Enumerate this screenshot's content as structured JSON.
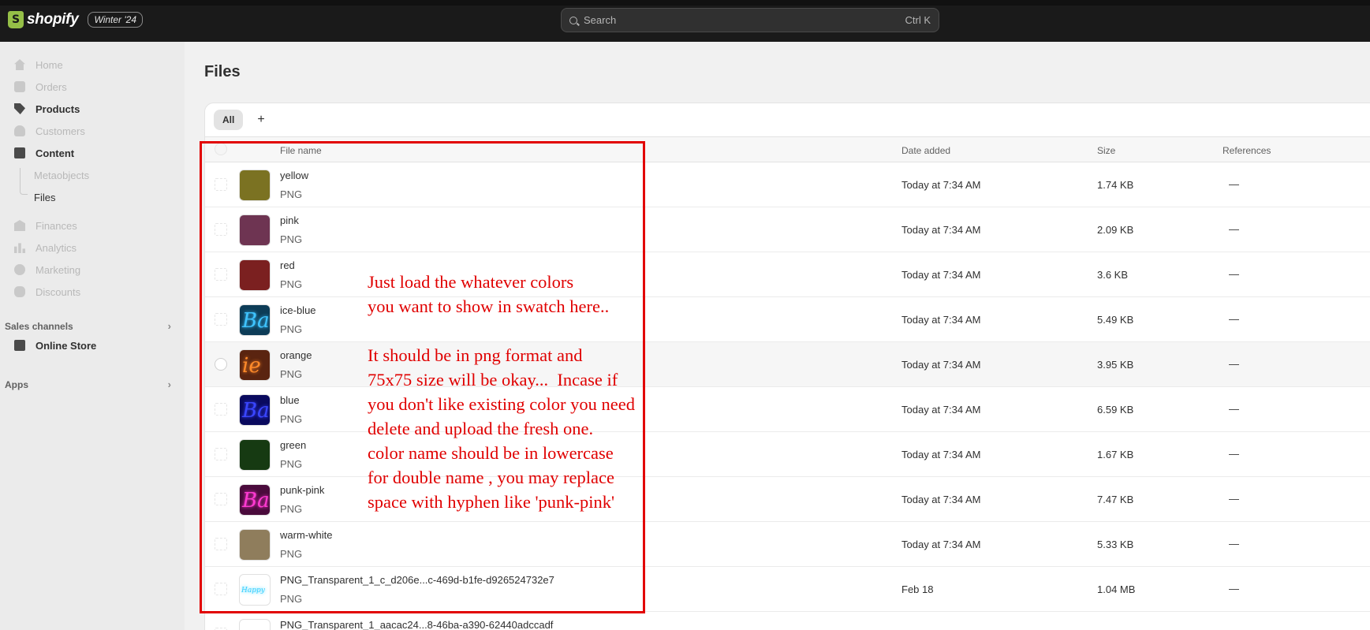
{
  "topbar": {
    "brand": "shopify",
    "version_badge": "Winter '24",
    "search_placeholder": "Search",
    "search_shortcut": "Ctrl K"
  },
  "sidebar": {
    "items": [
      {
        "label": "Home"
      },
      {
        "label": "Orders"
      },
      {
        "label": "Products"
      },
      {
        "label": "Customers"
      },
      {
        "label": "Content"
      },
      {
        "label": "Metaobjects"
      },
      {
        "label": "Files"
      },
      {
        "label": "Finances"
      },
      {
        "label": "Analytics"
      },
      {
        "label": "Marketing"
      },
      {
        "label": "Discounts"
      }
    ],
    "sales_channels": "Sales channels",
    "online_store": "Online Store",
    "apps": "Apps"
  },
  "page": {
    "title": "Files",
    "tab_all": "All",
    "tab_add": "+"
  },
  "table": {
    "headers": {
      "name": "File name",
      "date": "Date added",
      "size": "Size",
      "refs": "References"
    },
    "rows": [
      {
        "name": "yellow",
        "type": "PNG",
        "date": "Today at 7:34 AM",
        "size": "1.74 KB",
        "refs": "—",
        "swatch": "#7b7222"
      },
      {
        "name": "pink",
        "type": "PNG",
        "date": "Today at 7:34 AM",
        "size": "2.09 KB",
        "refs": "—",
        "swatch": "#6e3452"
      },
      {
        "name": "red",
        "type": "PNG",
        "date": "Today at 7:34 AM",
        "size": "3.6 KB",
        "refs": "—",
        "swatch": "#7b2020"
      },
      {
        "name": "ice-blue",
        "type": "PNG",
        "date": "Today at 7:34 AM",
        "size": "5.49 KB",
        "refs": "—",
        "swatch": "#0d3c57",
        "neon": "#3fc4ff",
        "neon_text": "Ba"
      },
      {
        "name": "orange",
        "type": "PNG",
        "date": "Today at 7:34 AM",
        "size": "3.95 KB",
        "refs": "—",
        "swatch": "#5a2410",
        "neon": "#ff8a2a",
        "neon_text": "ie"
      },
      {
        "name": "blue",
        "type": "PNG",
        "date": "Today at 7:34 AM",
        "size": "6.59 KB",
        "refs": "—",
        "swatch": "#0a0a5e",
        "neon": "#3a46ff",
        "neon_text": "Ba"
      },
      {
        "name": "green",
        "type": "PNG",
        "date": "Today at 7:34 AM",
        "size": "1.67 KB",
        "refs": "—",
        "swatch": "#163a12"
      },
      {
        "name": "punk-pink",
        "type": "PNG",
        "date": "Today at 7:34 AM",
        "size": "7.47 KB",
        "refs": "—",
        "swatch": "#4a0b3c",
        "neon": "#ff3ad2",
        "neon_text": "Ba"
      },
      {
        "name": "warm-white",
        "type": "PNG",
        "date": "Today at 7:34 AM",
        "size": "5.33 KB",
        "refs": "—",
        "swatch": "#8f7d5c"
      },
      {
        "name": "PNG_Transparent_1_c_d206e...c-469d-b1fe-d926524732e7",
        "type": "PNG",
        "date": "Feb 18",
        "size": "1.04 MB",
        "refs": "—",
        "swatch": "#ffffff",
        "neon": "#37d0ff",
        "neon_text": "Happy"
      },
      {
        "name": "PNG_Transparent_1_aacac24...8-46ba-a390-62440adccadf",
        "type": "",
        "date": "",
        "size": "",
        "refs": "",
        "swatch": "#ffffff"
      }
    ]
  },
  "annotation": {
    "line1": "Just load the whatever colors",
    "line2": "you want to show in swatch here..",
    "line3": "It should be in png format and",
    "line4": "75x75 size will be okay...  Incase if",
    "line5": "you don't like existing color you need",
    "line6": "delete and upload the fresh one.",
    "line7": "color name should be in lowercase",
    "line8": "for double name , you may replace",
    "line9": "space with hyphen like 'punk-pink'"
  }
}
